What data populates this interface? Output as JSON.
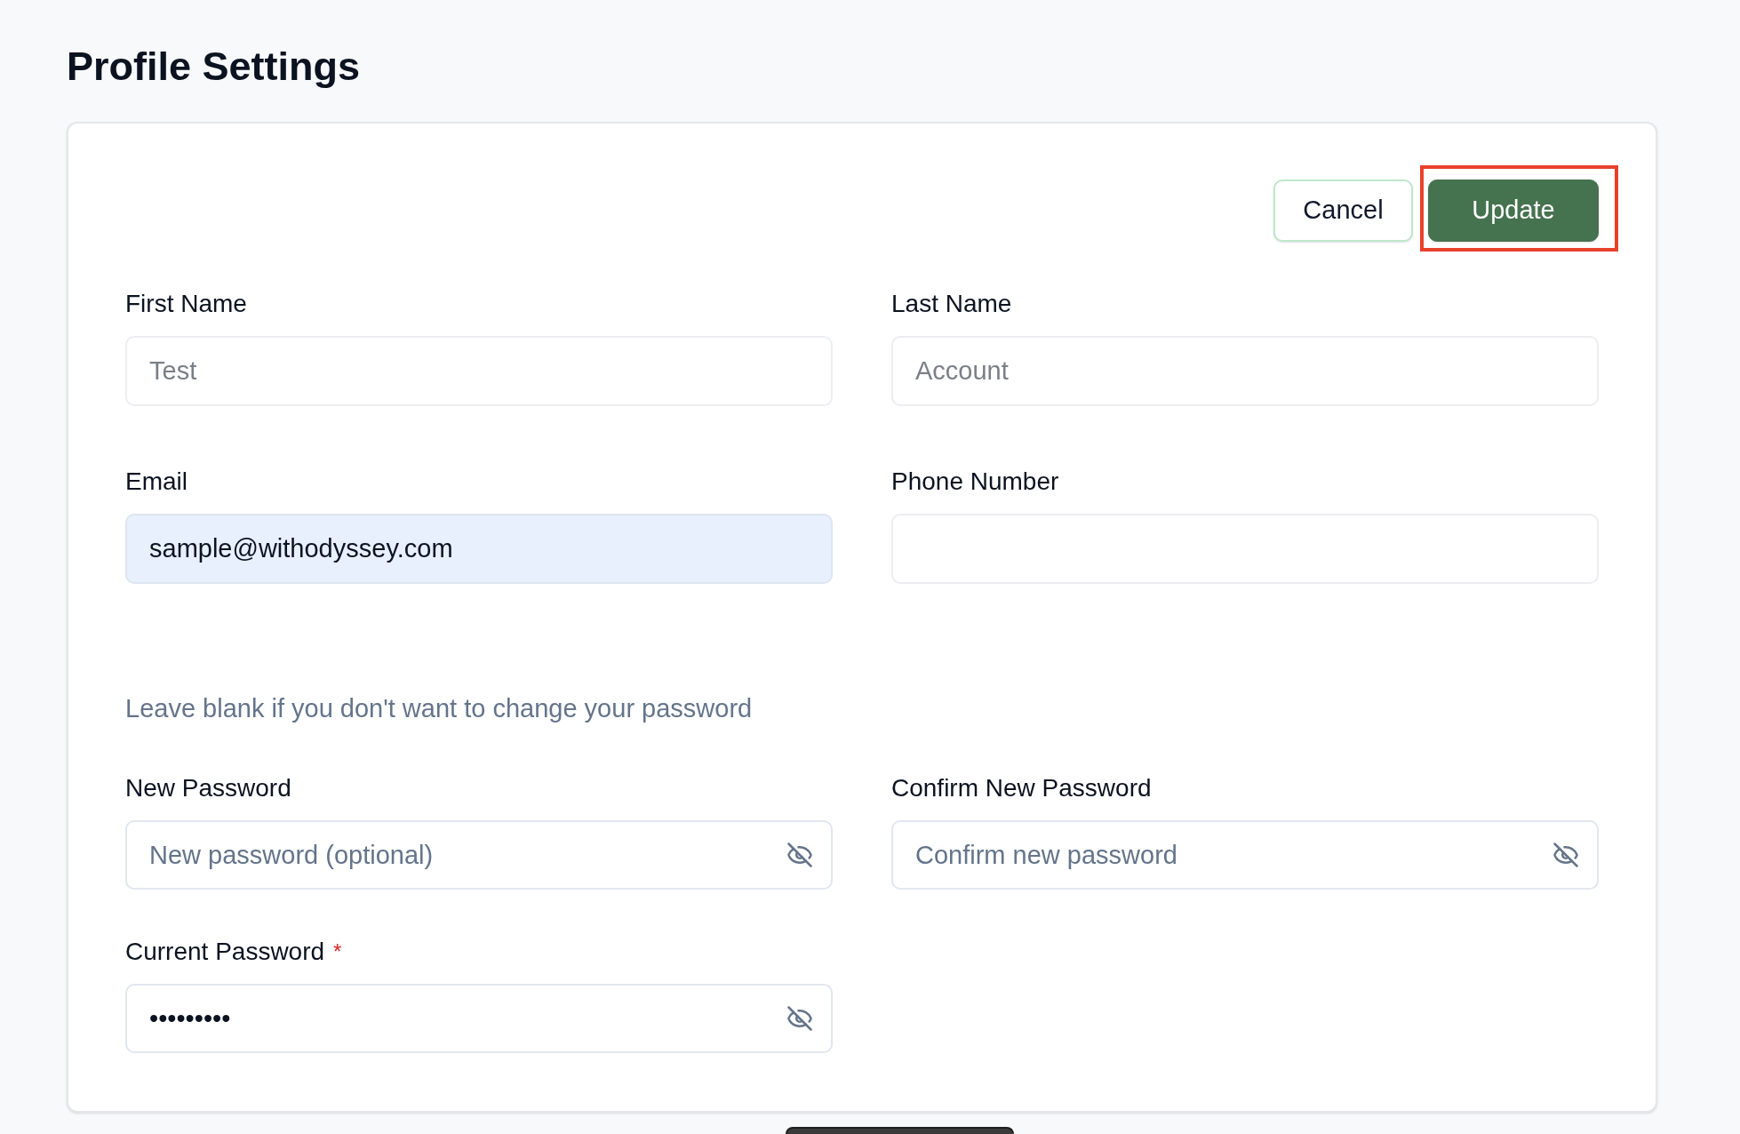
{
  "page": {
    "title": "Profile Settings"
  },
  "actions": [
    {
      "label": "Cancel",
      "kind": "secondary",
      "highlighted": false
    },
    {
      "label": "Update",
      "kind": "primary",
      "highlighted": true
    }
  ],
  "fields": [
    {
      "label": "First Name",
      "placeholder": "Test",
      "autofilled": false
    },
    {
      "label": "Last Name",
      "placeholder": "Account",
      "autofilled": false
    },
    {
      "label": "Email",
      "value": "sample@withodyssey.com",
      "autofilled": true
    },
    {
      "label": "Phone Number",
      "autofilled": false
    }
  ],
  "password_note": "Leave blank if you don't want to change your password",
  "password_fields": [
    {
      "label": "New Password",
      "placeholder": "New password (optional)",
      "visible": false
    },
    {
      "label": "Confirm New Password",
      "placeholder": "Confirm new password",
      "visible": false
    },
    {
      "label": "Current Password",
      "required_mark": "*",
      "value": "•••••••••",
      "visible": false
    }
  ]
}
